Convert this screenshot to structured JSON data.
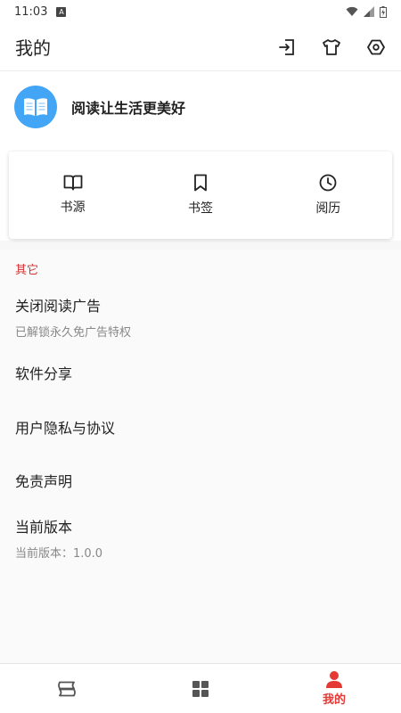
{
  "status_bar": {
    "time": "11:03",
    "notification_letter": "A"
  },
  "app_bar": {
    "title": "我的",
    "actions": [
      "exit-icon",
      "tshirt-icon",
      "settings-icon"
    ]
  },
  "profile": {
    "slogan": "阅读让生活更美好",
    "avatar_icon": "open-book-icon",
    "avatar_color": "#42a5f5"
  },
  "quick_links": [
    {
      "label": "书源",
      "icon": "book-icon"
    },
    {
      "label": "书签",
      "icon": "bookmark-icon"
    },
    {
      "label": "阅历",
      "icon": "clock-icon"
    }
  ],
  "other_section": {
    "header": "其它",
    "items": [
      {
        "title": "关闭阅读广告",
        "subtitle": "已解锁永久免广告特权"
      },
      {
        "title": "软件分享"
      },
      {
        "title": "用户隐私与协议"
      },
      {
        "title": "免责声明"
      },
      {
        "title": "当前版本",
        "subtitle": "当前版本：1.0.0"
      }
    ]
  },
  "bottom_nav": {
    "items": [
      {
        "icon": "bookshelf-icon"
      },
      {
        "icon": "grid-icon"
      },
      {
        "icon": "person-icon",
        "label": "我的",
        "active": true
      }
    ],
    "active_color": "#e53935"
  },
  "colors": {
    "accent": "#e53935",
    "section_header": "#d32f2f"
  }
}
